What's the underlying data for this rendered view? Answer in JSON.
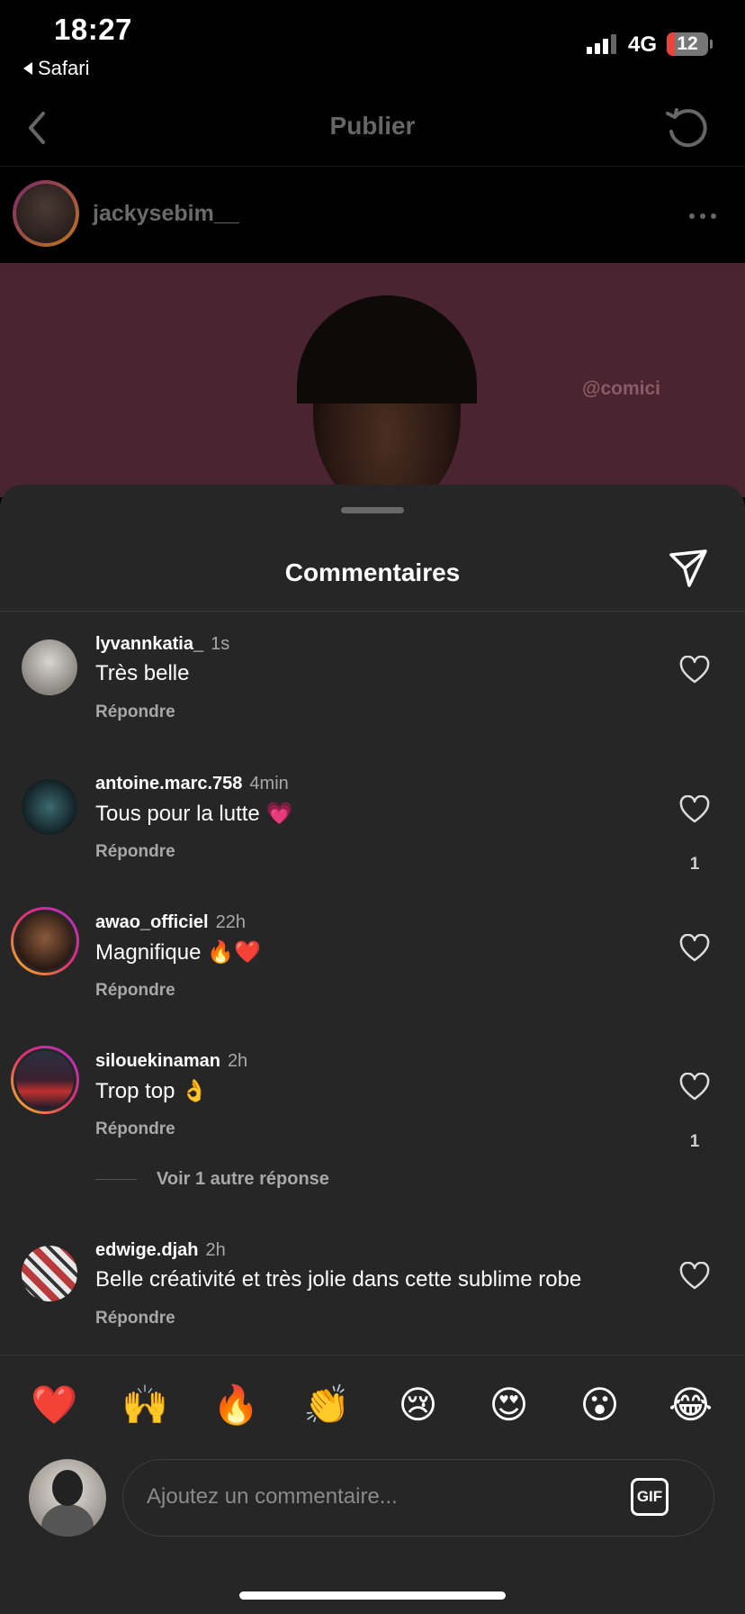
{
  "status_bar": {
    "time": "18:27",
    "back_app": "Safari",
    "network": "4G",
    "battery": "12"
  },
  "header": {
    "title": "Publier"
  },
  "post": {
    "username": "jackysebim__",
    "watermark": "@comici"
  },
  "sheet": {
    "title": "Commentaires"
  },
  "comments": [
    {
      "user": "lyvannkatia_",
      "time": "1s",
      "text": "Très belle",
      "reply": "Répondre",
      "likes": ""
    },
    {
      "user": "antoine.marc.758",
      "time": "4min",
      "text": "Tous pour la lutte 💗",
      "reply": "Répondre",
      "likes": "1"
    },
    {
      "user": "awao_officiel",
      "time": "22h",
      "text": "Magnifique 🔥❤️",
      "reply": "Répondre",
      "likes": ""
    },
    {
      "user": "silouekinaman",
      "time": "2h",
      "text": "Trop top 👌",
      "reply": "Répondre",
      "likes": "1"
    },
    {
      "user": "edwige.djah",
      "time": "2h",
      "text": "Belle créativité et très jolie dans cette sublime robe",
      "reply": "Répondre",
      "likes": ""
    }
  ],
  "more_replies": "Voir 1 autre réponse",
  "quick_emojis": [
    "❤️",
    "🙌",
    "🔥",
    "👏",
    "😢",
    "😍",
    "😮",
    "😂"
  ],
  "composer": {
    "placeholder": "Ajoutez un commentaire...",
    "gif_label": "GIF"
  }
}
